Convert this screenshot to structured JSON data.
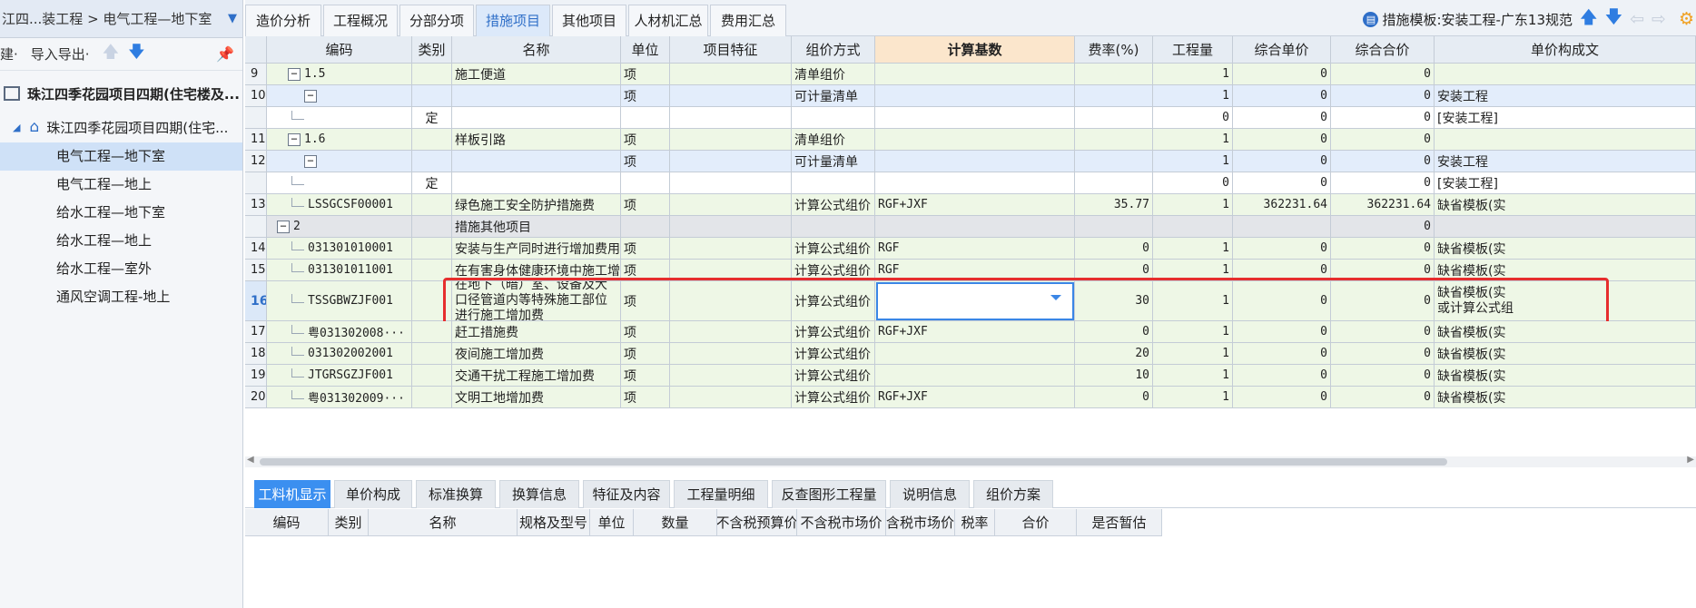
{
  "left_panel": {
    "breadcrumb": "江四...装工程 > 电气工程—地下室",
    "tool_new": "建·",
    "tool_import_export": "导入导出·",
    "tree_root": "珠江四季花园项目四期(住宅楼及...",
    "tree_sub": "珠江四季花园项目四期(住宅...",
    "items": [
      {
        "label": "电气工程—地下室",
        "selected": true
      },
      {
        "label": "电气工程—地上",
        "selected": false
      },
      {
        "label": "给水工程—地下室",
        "selected": false
      },
      {
        "label": "给水工程—地上",
        "selected": false
      },
      {
        "label": "给水工程—室外",
        "selected": false
      },
      {
        "label": "通风空调工程-地上",
        "selected": false
      }
    ]
  },
  "top_tabs": [
    "造价分析",
    "工程概况",
    "分部分项",
    "措施项目",
    "其他项目",
    "人材机汇总",
    "费用汇总"
  ],
  "active_tab": "措施项目",
  "template_label": "措施模板:安装工程-广东13规范",
  "columns": [
    "编码",
    "类别",
    "名称",
    "单位",
    "项目特征",
    "组价方式",
    "计算基数",
    "费率(%)",
    "工程量",
    "综合单价",
    "综合合价",
    "单价构成文"
  ],
  "rows": [
    {
      "rn": "9",
      "code": "1.5",
      "ctrl": "−",
      "type": "",
      "name": "施工便道",
      "unit": "项",
      "method": "清单组价",
      "base": "",
      "rate": "",
      "qty": "1",
      "up": "0",
      "tp": "0",
      "comp": "",
      "style": "green"
    },
    {
      "rn": "10",
      "code": "",
      "ctrl": "−",
      "type": "",
      "name": "",
      "unit": "项",
      "method": "可计量清单",
      "base": "",
      "rate": "",
      "qty": "1",
      "up": "0",
      "tp": "0",
      "comp": "安装工程",
      "style": "blue"
    },
    {
      "rn": "",
      "code": "",
      "ctrl": "",
      "type": "定",
      "name": "",
      "unit": "",
      "method": "",
      "base": "",
      "rate": "",
      "qty": "0",
      "up": "0",
      "tp": "0",
      "comp": "[安装工程]",
      "style": "white"
    },
    {
      "rn": "11",
      "code": "1.6",
      "ctrl": "−",
      "type": "",
      "name": "样板引路",
      "unit": "项",
      "method": "清单组价",
      "base": "",
      "rate": "",
      "qty": "1",
      "up": "0",
      "tp": "0",
      "comp": "",
      "style": "green"
    },
    {
      "rn": "12",
      "code": "",
      "ctrl": "−",
      "type": "",
      "name": "",
      "unit": "项",
      "method": "可计量清单",
      "base": "",
      "rate": "",
      "qty": "1",
      "up": "0",
      "tp": "0",
      "comp": "安装工程",
      "style": "blue"
    },
    {
      "rn": "",
      "code": "",
      "ctrl": "",
      "type": "定",
      "name": "",
      "unit": "",
      "method": "",
      "base": "",
      "rate": "",
      "qty": "0",
      "up": "0",
      "tp": "0",
      "comp": "[安装工程]",
      "style": "white"
    },
    {
      "rn": "13",
      "code": "LSSGCSF00001",
      "ctrl": "",
      "type": "",
      "name": "绿色施工安全防护措施费",
      "unit": "项",
      "method": "计算公式组价",
      "base": "RGF+JXF",
      "rate": "35.77",
      "qty": "1",
      "up": "362231.64",
      "tp": "362231.64",
      "comp": "缺省模板(实",
      "style": "green"
    },
    {
      "rn": "",
      "code": "2",
      "ctrl": "−",
      "type": "",
      "name": "措施其他项目",
      "unit": "",
      "method": "",
      "base": "",
      "rate": "",
      "qty": "",
      "up": "",
      "tp": "0",
      "comp": "",
      "style": "gray"
    },
    {
      "rn": "14",
      "code": "031301010001",
      "ctrl": "",
      "type": "",
      "name": "安装与生产同时进行增加费用",
      "unit": "项",
      "method": "计算公式组价",
      "base": "RGF",
      "rate": "0",
      "qty": "1",
      "up": "0",
      "tp": "0",
      "comp": "缺省模板(实",
      "style": "green"
    },
    {
      "rn": "15",
      "code": "031301011001",
      "ctrl": "",
      "type": "",
      "name": "在有害身体健康环境中施工增加费",
      "unit": "项",
      "method": "计算公式组价",
      "base": "RGF",
      "rate": "0",
      "qty": "1",
      "up": "0",
      "tp": "0",
      "comp": "缺省模板(实",
      "style": "green"
    },
    {
      "rn": "16",
      "code": "TSSGBWZJF001",
      "ctrl": "",
      "type": "",
      "name": "在地下（暗）室、设备及大口径管道内等特殊施工部位进行施工增加费",
      "unit": "项",
      "method": "计算公式组价",
      "base": "",
      "rate": "30",
      "qty": "1",
      "up": "0",
      "tp": "0",
      "comp": "缺省模板(实",
      "comp2": "或计算公式组",
      "style": "green",
      "current": true
    },
    {
      "rn": "17",
      "code": "粤031302008···",
      "ctrl": "",
      "type": "",
      "name": "赶工措施费",
      "unit": "项",
      "method": "计算公式组价",
      "base": "RGF+JXF",
      "rate": "0",
      "qty": "1",
      "up": "0",
      "tp": "0",
      "comp": "缺省模板(实",
      "style": "green"
    },
    {
      "rn": "18",
      "code": "031302002001",
      "ctrl": "",
      "type": "",
      "name": "夜间施工增加费",
      "unit": "项",
      "method": "计算公式组价",
      "base": "",
      "rate": "20",
      "qty": "1",
      "up": "0",
      "tp": "0",
      "comp": "缺省模板(实",
      "style": "green"
    },
    {
      "rn": "19",
      "code": "JTGRSGZJF001",
      "ctrl": "",
      "type": "",
      "name": "交通干扰工程施工增加费",
      "unit": "项",
      "method": "计算公式组价",
      "base": "",
      "rate": "10",
      "qty": "1",
      "up": "0",
      "tp": "0",
      "comp": "缺省模板(实",
      "style": "green"
    },
    {
      "rn": "20",
      "code": "粤031302009···",
      "ctrl": "",
      "type": "",
      "name": "文明工地增加费",
      "unit": "项",
      "method": "计算公式组价",
      "base": "RGF+JXF",
      "rate": "0",
      "qty": "1",
      "up": "0",
      "tp": "0",
      "comp": "缺省模板(实",
      "style": "green"
    }
  ],
  "bottom_tabs": [
    "工料机显示",
    "单价构成",
    "标准换算",
    "换算信息",
    "特征及内容",
    "工程量明细",
    "反查图形工程量",
    "说明信息",
    "组价方案"
  ],
  "bottom_active": "工料机显示",
  "bottom_columns": [
    "编码",
    "类别",
    "名称",
    "规格及型号",
    "单位",
    "数量",
    "不含税预算价",
    "不含税市场价",
    "含税市场价",
    "税率",
    "合价",
    "是否暂估"
  ],
  "colors": {
    "row_green": "#eef7e6",
    "row_blue": "#e3edfb",
    "row_gray": "#e3e5e9",
    "accent": "#2f6fc8",
    "highlight_border": "#e62e2e"
  },
  "icons": [
    "dropdown-caret-icon",
    "arrow-up-icon",
    "arrow-down-icon",
    "pin-icon",
    "building-icon",
    "home-icon",
    "template-icon",
    "arrow-left-icon",
    "arrow-right-icon",
    "settings-icon",
    "collapse-icon",
    "combo-caret-icon"
  ]
}
